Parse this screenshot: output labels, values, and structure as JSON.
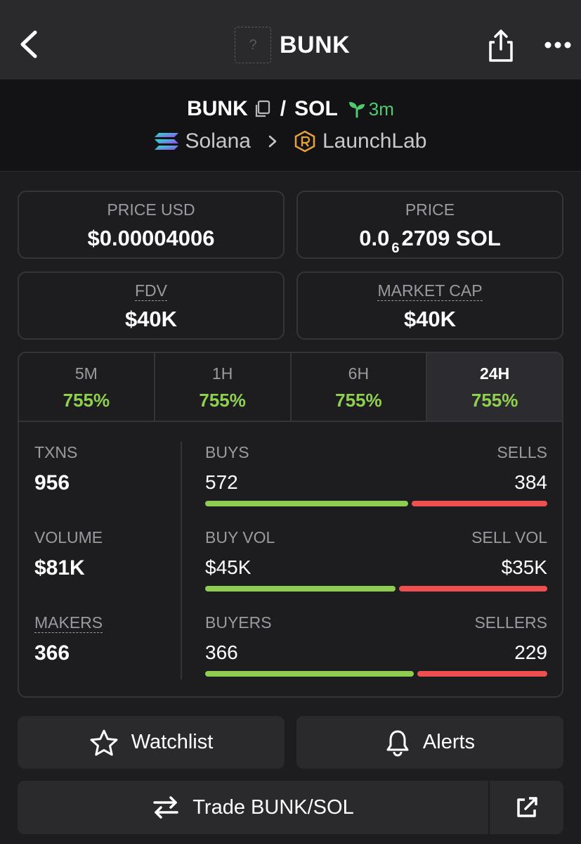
{
  "topbar": {
    "title": "BUNK",
    "token_placeholder": "?"
  },
  "pair": {
    "base": "BUNK",
    "slash": "/",
    "quote": "SOL",
    "age": "3m",
    "chain": "Solana",
    "dex": "LaunchLab"
  },
  "stats": {
    "price_usd_label": "PRICE USD",
    "price_usd": "$0.00004006",
    "price_label": "PRICE",
    "price_prefix": "0.0",
    "price_zeros": "6",
    "price_rest": "2709 SOL",
    "fdv_label": "FDV",
    "fdv": "$40K",
    "mcap_label": "MARKET CAP",
    "mcap": "$40K"
  },
  "timeframes": [
    {
      "label": "5M",
      "change": "755%"
    },
    {
      "label": "1H",
      "change": "755%"
    },
    {
      "label": "6H",
      "change": "755%"
    },
    {
      "label": "24H",
      "change": "755%"
    }
  ],
  "metrics": {
    "txns_label": "TXNS",
    "txns": "956",
    "volume_label": "VOLUME",
    "volume": "$81K",
    "makers_label": "MAKERS",
    "makers": "366"
  },
  "splits": {
    "buys_label": "BUYS",
    "buys": "572",
    "sells_label": "SELLS",
    "sells": "384",
    "buys_fraction": 0.598,
    "buyvol_label": "BUY VOL",
    "buyvol": "$45K",
    "sellvol_label": "SELL VOL",
    "sellvol": "$35K",
    "buyvol_fraction": 0.562,
    "buyers_label": "BUYERS",
    "buyers": "366",
    "sellers_label": "SELLERS",
    "sellers": "229",
    "buyers_fraction": 0.615
  },
  "actions": {
    "watchlist": "Watchlist",
    "alerts": "Alerts",
    "trade": "Trade BUNK/SOL"
  },
  "colors": {
    "positive": "#8fd14f",
    "buy_bar": "#8fcc52",
    "sell_bar": "#ee5050",
    "age": "#4ecb71"
  }
}
